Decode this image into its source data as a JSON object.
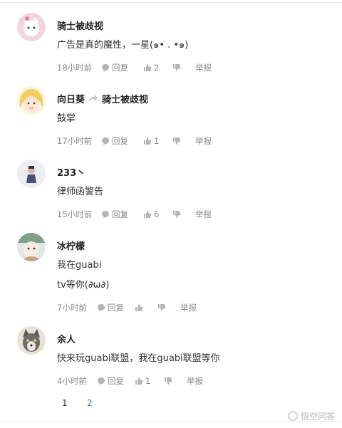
{
  "comments": [
    {
      "username": "骑士被歧视",
      "reply_to": "",
      "lines": [
        "广告是真的魔性，一星(๑• . •๑)"
      ],
      "time": "18小时前",
      "reply_label": "回复",
      "likes": "2",
      "report_label": "举报"
    },
    {
      "username": "向日葵",
      "reply_to": "骑士被歧视",
      "lines": [
        "鼓掌"
      ],
      "time": "17小时前",
      "reply_label": "回复",
      "likes": "1",
      "report_label": "举报"
    },
    {
      "username": "233丶",
      "reply_to": "",
      "lines": [
        "律师函警告"
      ],
      "time": "15小时前",
      "reply_label": "回复",
      "likes": "6",
      "report_label": "举报"
    },
    {
      "username": "冰柠檬",
      "reply_to": "",
      "lines": [
        "我在guabi",
        "tv等你(∂ω∂)"
      ],
      "time": "7小时前",
      "reply_label": "回复",
      "likes": "",
      "report_label": "举报"
    },
    {
      "username": "余人",
      "reply_to": "",
      "lines": [
        "快来玩guabi联盟，我在guabi联盟等你"
      ],
      "time": "4小时前",
      "reply_label": "回复",
      "likes": "1",
      "report_label": "举报"
    }
  ],
  "pagination": {
    "pages": [
      "1",
      "2"
    ],
    "current": "2"
  },
  "watermark": {
    "text": "悟空问答"
  },
  "colors": {
    "accent": "#3a6fc6",
    "meta": "#8a8a8a",
    "divider": "#e9e9e9"
  },
  "icons": {
    "comment": "speech-bubble-icon",
    "like": "thumbs-up-icon",
    "dislike": "thumbs-down-icon",
    "reply_to": "reply-arrow-icon"
  }
}
